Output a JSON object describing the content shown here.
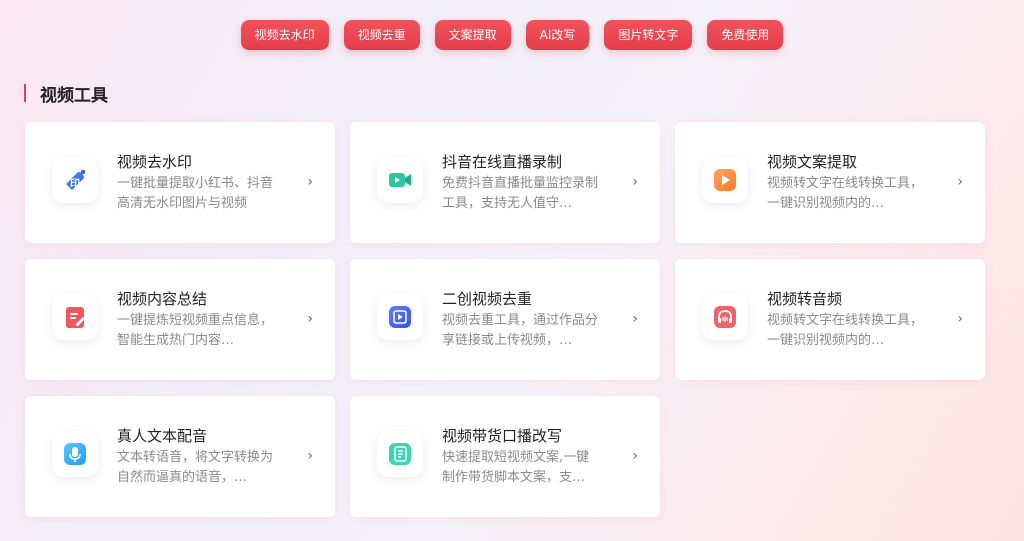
{
  "tags": [
    "视频去水印",
    "视频去重",
    "文案提取",
    "AI改写",
    "图片转文字",
    "免费使用"
  ],
  "section": {
    "title": "视频工具"
  },
  "cards": [
    {
      "title": "视频去水印",
      "desc": "一键批量提取小红书、抖音高清无水印图片与视频",
      "icon": "watermark-icon"
    },
    {
      "title": "抖音在线直播录制",
      "desc": "免费抖音直播批量监控录制工具，支持无人值守…",
      "icon": "video-camera-icon"
    },
    {
      "title": "视频文案提取",
      "desc": "视频转文字在线转换工具，一键识别视频内的…",
      "icon": "play-icon"
    },
    {
      "title": "视频内容总结",
      "desc": "一键提炼短视频重点信息，智能生成热门内容…",
      "icon": "document-edit-icon"
    },
    {
      "title": "二创视频去重",
      "desc": "视频去重工具，通过作品分享链接或上传视频，…",
      "icon": "video-file-icon"
    },
    {
      "title": "视频转音频",
      "desc": "视频转文字在线转换工具，一键识别视频内的…",
      "icon": "headphones-icon"
    },
    {
      "title": "真人文本配音",
      "desc": "文本转语音，将文字转换为自然而逼真的语音，…",
      "icon": "microphone-icon"
    },
    {
      "title": "视频带货口播改写",
      "desc": "快速提取短视频文案,一键制作带货脚本文案，支…",
      "icon": "script-icon"
    }
  ],
  "chevron": "›"
}
